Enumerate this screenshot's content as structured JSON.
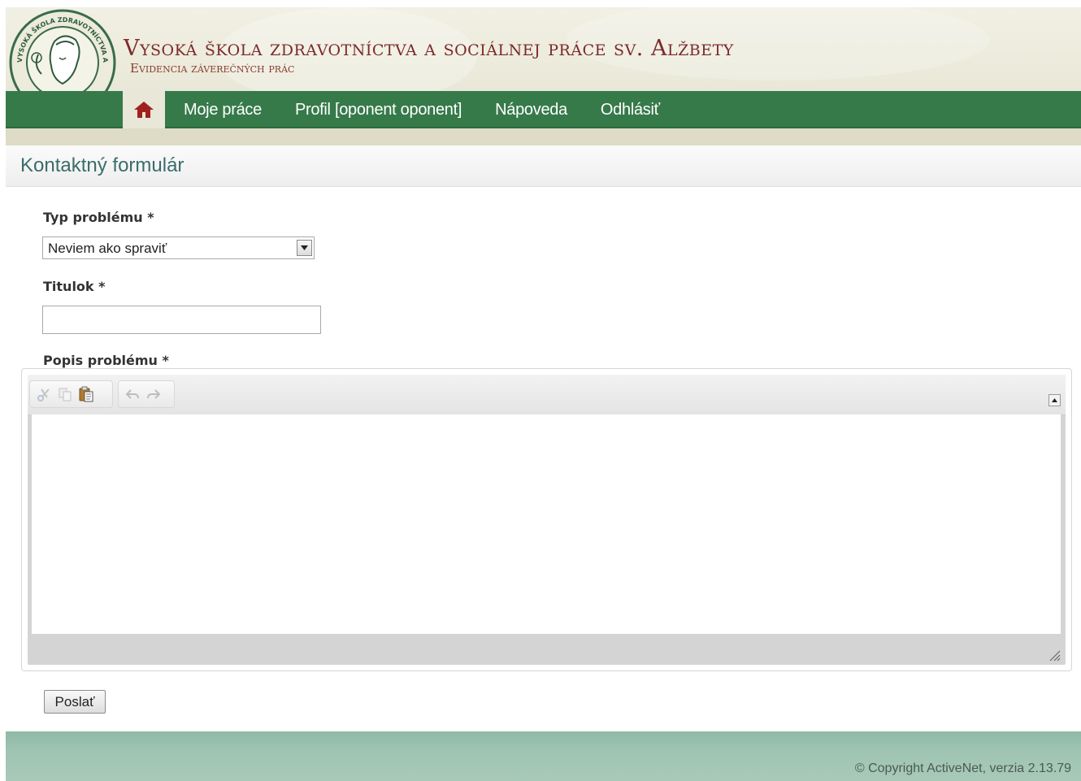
{
  "header": {
    "title": "Vysoká škola zdravotníctva a sociálnej  práce sv. Alžbety",
    "subtitle": "Evidencia záverečných prác",
    "logo_text": "VYSOKÁ ŠKOLA ZDRAVOTNÍCTVA A SOCIÁLNEJ PRÁCE SV. ALŽBETY"
  },
  "nav": {
    "home_icon": "home-icon",
    "items": [
      {
        "label": "Moje práce"
      },
      {
        "label": "Profil [oponent oponent]"
      },
      {
        "label": "Nápoveda"
      },
      {
        "label": "Odhlásiť"
      }
    ]
  },
  "page": {
    "title": "Kontaktný formulár"
  },
  "form": {
    "type_label": "Typ problému *",
    "type_value": "Neviem ako spraviť",
    "title_label": "Titulok *",
    "title_value": "",
    "description_label": "Popis problému *",
    "submit_label": "Poslať"
  },
  "editor": {
    "toolbar_icons": [
      "cut-icon",
      "copy-icon",
      "paste-icon",
      "undo-icon",
      "redo-icon"
    ]
  },
  "footer": {
    "copyright": "© Copyright ActiveNet, verzia 2.13.79"
  },
  "colors": {
    "nav_bg": "#367a4a",
    "title_text": "#7b2a2a",
    "page_title": "#3a6d6a",
    "footer_bg": "#9fc4b3"
  }
}
